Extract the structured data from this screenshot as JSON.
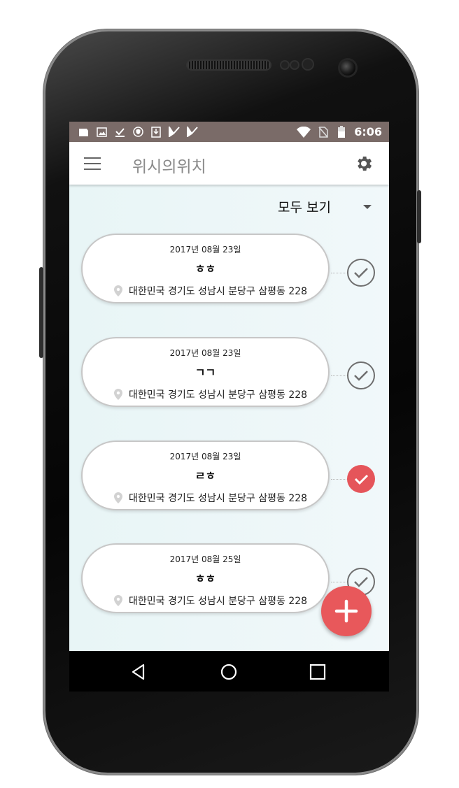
{
  "statusbar": {
    "time": "6:06",
    "left_icons": [
      "notification-icon",
      "image-icon",
      "check-download-icon",
      "shield-icon",
      "download-icon",
      "app-icon",
      "app-icon"
    ],
    "right_icons": [
      "wifi-icon",
      "no-sim-icon",
      "battery-icon"
    ]
  },
  "appbar": {
    "title": "위시의위치",
    "menu_icon": "menu-icon",
    "settings_icon": "gear-icon"
  },
  "filter": {
    "selected": "모두 보기"
  },
  "cards": [
    {
      "date": "2017년 08월 23일",
      "title": "ㅎㅎ",
      "address": "대한민국 경기도 성남시 분당구 삼평동 228",
      "checked": false
    },
    {
      "date": "2017년 08월 23일",
      "title": "ㄱㄱ",
      "address": "대한민국 경기도 성남시 분당구 삼평동 228",
      "checked": false
    },
    {
      "date": "2017년 08월 23일",
      "title": "ㄹㅎ",
      "address": "대한민국 경기도 성남시 분당구 삼평동 228",
      "checked": true
    },
    {
      "date": "2017년 08월 25일",
      "title": "ㅎㅎ",
      "address": "대한민국 경기도 성남시 분당구 삼평동 228",
      "checked": false
    }
  ],
  "colors": {
    "statusbar": "#7a6b68",
    "accent": "#e8585b",
    "background": "#eef7f9",
    "checked": "#e5555a"
  },
  "fab": {
    "icon": "plus-icon"
  },
  "navbar": {
    "icons": [
      "back-icon",
      "home-icon",
      "recents-icon"
    ]
  }
}
